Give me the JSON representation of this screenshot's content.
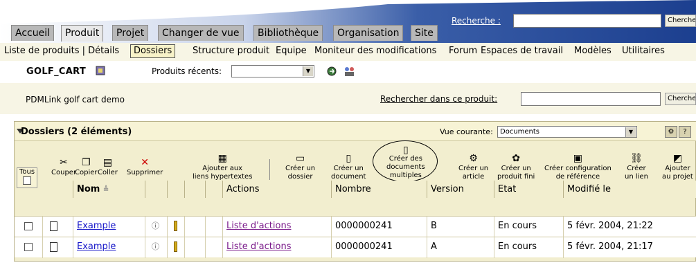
{
  "colors": {
    "banner": "#1c3f8f",
    "accent_bg": "#f7f5e5",
    "link": "#1515c8",
    "visited_link": "#7a1a8a",
    "delete_x": "#cc0000"
  },
  "top_tabs": [
    "Accueil",
    "Produit",
    "Projet",
    "Changer de vue",
    "Bibliothèque",
    "Organisation",
    "Site"
  ],
  "active_top_tab": "Produit",
  "search": {
    "label": "Recherche :",
    "button": "Chercher"
  },
  "subnav": {
    "items": [
      "Liste de produits | Détails",
      "Dossiers",
      "Structure produit",
      "Equipe",
      "Moniteur des modifications",
      "Forum",
      "Espaces de travail",
      "Modèles",
      "Utilitaires"
    ],
    "active": "Dossiers"
  },
  "product": {
    "name": "GOLF_CART",
    "recent_label": "Produits récents:",
    "recent_value": ""
  },
  "context": {
    "title": "PDMLink golf cart demo",
    "search_link": "Rechercher dans ce produit:",
    "search_button": "Chercher"
  },
  "panel": {
    "title": "Dossiers (2 éléments)",
    "view_label": "Vue courante:",
    "view_value": "Documents",
    "tous_label": "Tous",
    "toolbar": [
      {
        "icon": "scissors-icon",
        "label1": "Couper",
        "label2": ""
      },
      {
        "icon": "copy-icon",
        "label1": "Copier",
        "label2": ""
      },
      {
        "icon": "paste-icon",
        "label1": "Coller",
        "label2": ""
      },
      {
        "icon": "delete-icon",
        "label1": "Supprimer",
        "label2": ""
      },
      {
        "icon": "hyperlink-icon",
        "label1": "Ajouter aux",
        "label2": "liens hypertextes"
      },
      {
        "icon": "new-folder-icon",
        "label1": "Créer un",
        "label2": "dossier"
      },
      {
        "icon": "new-document-icon",
        "label1": "Créer un",
        "label2": "document"
      },
      {
        "icon": "new-multiple-documents-icon",
        "label1": "Créer des",
        "label2": "documents",
        "label3": "multiples"
      },
      {
        "icon": "new-article-icon",
        "label1": "Créer un",
        "label2": "article"
      },
      {
        "icon": "new-product-icon",
        "label1": "Créer un",
        "label2": "produit fini"
      },
      {
        "icon": "baseline-icon",
        "label1": "Créer configuration",
        "label2": "de référence"
      },
      {
        "icon": "new-link-icon",
        "label1": "Créer",
        "label2": "un lien"
      },
      {
        "icon": "add-to-project-icon",
        "label1": "Ajouter",
        "label2": "au projet"
      }
    ],
    "columns": {
      "name": "Nom",
      "actions": "Actions",
      "number": "Nombre",
      "version": "Version",
      "state": "Etat",
      "modified": "Modifié le"
    },
    "rows": [
      {
        "name": "Example",
        "actions": "Liste d'actions",
        "number": "0000000241",
        "version": "B",
        "state": "En cours",
        "modified": "5 févr. 2004, 21:22"
      },
      {
        "name": "Example",
        "actions": "Liste d'actions",
        "number": "0000000241",
        "version": "A",
        "state": "En cours",
        "modified": "5 févr. 2004, 21:17"
      }
    ]
  }
}
